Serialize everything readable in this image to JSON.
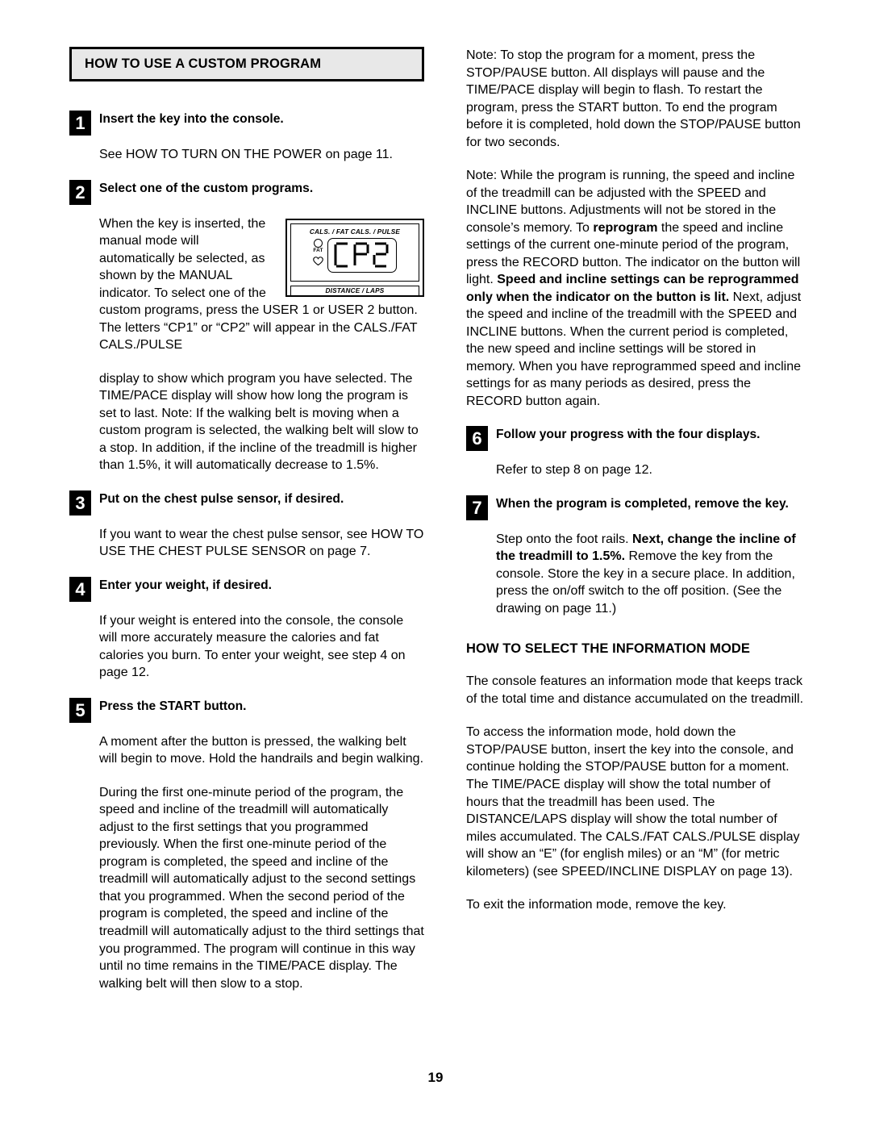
{
  "document": {
    "page_number": "19"
  },
  "left_column": {
    "section_heading": "HOW TO USE A CUSTOM PROGRAM",
    "steps": [
      {
        "number": "1",
        "title": "Insert the key into the console.",
        "body_1": "See HOW TO TURN ON THE POWER on page 11."
      },
      {
        "number": "2",
        "title": "Select one of the custom programs.",
        "body_1": "When the key is inserted, the manual mode will automatically be selected, as shown by the MANUAL indicator. To select one of the custom programs, press the USER 1 or USER 2 button. The letters “CP1” or “CP2” will appear in the CALS./FAT CALS./PULSE",
        "body_2": "display to show which program you have selected. The TIME/PACE display will show how long the program is set to last. Note: If the walking belt is moving when a custom program is selected, the walking belt will slow to a stop. In addition, if the incline of the treadmill is higher than 1.5%, it will automatically decrease to 1.5%."
      },
      {
        "number": "3",
        "title": "Put on the chest pulse sensor, if desired.",
        "body_1": "If you want to wear the chest pulse sensor, see HOW TO USE THE CHEST PULSE SENSOR on page 7."
      },
      {
        "number": "4",
        "title": "Enter your weight, if desired.",
        "body_1": "If your weight is entered into the console, the console will more accurately measure the calories and fat calories you burn. To enter your weight, see step 4 on page 12."
      },
      {
        "number": "5",
        "title": "Press the START button.",
        "body_1": "A moment after the button is pressed, the walking belt will begin to move. Hold the handrails and begin walking.",
        "body_2": "During the first one-minute period of the program, the speed and incline of the treadmill will automatically adjust to the first settings that you programmed previously. When the first one-minute period of the program is completed, the speed and incline of the treadmill will automatically adjust to the second settings that you programmed. When the second period of the program is completed, the speed and incline of the treadmill will automatically adjust to the third settings that you programmed. The program will continue in this way until no time remains in the TIME/PACE display. The walking belt will then slow to a stop."
      }
    ],
    "figure": {
      "top_label": "CALS. / FAT CALS. / PULSE",
      "segment_value": "CP2",
      "fat_indicator_label": "FAT",
      "bottom_label": "DISTANCE / LAPS"
    }
  },
  "right_column": {
    "note_1": "Note: To stop the program for a moment, press the STOP/PAUSE button. All displays will pause and the TIME/PACE display will begin to flash. To restart the program, press the START button. To end the program before it is completed, hold down the STOP/PAUSE button for two seconds.",
    "note_2_part_1": "Note: While the program is running, the speed and incline of the treadmill can be adjusted with the SPEED and INCLINE buttons. Adjustments will not be stored in the console’s memory. To ",
    "note_2_bold_1": "reprogram",
    "note_2_part_2": " the speed and incline settings of the current one-minute period of the program, press the RECORD button. The indicator on the button will light. ",
    "note_2_bold_2": "Speed and incline settings can be reprogrammed only when the indicator on the button is lit.",
    "note_2_part_3": " Next, adjust the speed and incline of the treadmill with the SPEED and INCLINE buttons. When the current period is completed, the new speed and incline settings will be stored in memory. When you have reprogrammed speed and incline settings for as many periods as desired, press the RECORD button again.",
    "steps": [
      {
        "number": "6",
        "title": "Follow your progress with the four displays.",
        "body_1": "Refer to step 8 on page 12."
      },
      {
        "number": "7",
        "title": "When the program is completed, remove the key.",
        "body_part_1": "Step onto the foot rails. ",
        "body_bold_1": "Next, change the incline of the treadmill to 1.5%.",
        "body_part_2": " Remove the key from the console. Store the key in a secure place. In addition, press the on/off switch to the off position. (See the drawing on page 11.)"
      }
    ],
    "info_mode": {
      "heading": "HOW TO SELECT THE INFORMATION MODE",
      "paragraph_1": "The console features an information mode that keeps track of the total time and distance accumulated on the treadmill.",
      "paragraph_2": "To access the information mode, hold down the STOP/PAUSE button, insert the key into the console, and continue holding the STOP/PAUSE button for a moment. The TIME/PACE display will show the total number of hours that the treadmill has been used. The DISTANCE/LAPS display will show the total number of miles accumulated. The CALS./FAT CALS./PULSE display will show an “E” (for english miles) or an “M” (for metric kilometers) (see SPEED/INCLINE DISPLAY on page 13).",
      "paragraph_3": "To exit the information mode, remove the key."
    }
  }
}
